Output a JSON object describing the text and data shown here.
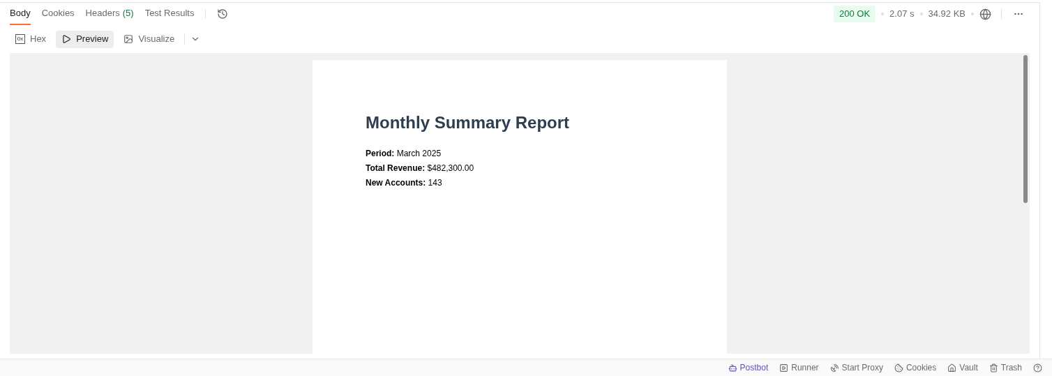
{
  "tabs": [
    {
      "label": "Body",
      "selected": true
    },
    {
      "label": "Cookies",
      "selected": false
    },
    {
      "label": "Headers",
      "count": "(5)",
      "selected": false
    },
    {
      "label": "Test Results",
      "selected": false
    }
  ],
  "status": {
    "code": "200 OK",
    "time": "2.07 s",
    "size": "34.92 KB"
  },
  "modes": [
    {
      "kind": "hex",
      "icon_text": "0x",
      "label": "Hex",
      "selected": false
    },
    {
      "kind": "preview",
      "label": "Preview",
      "selected": true
    },
    {
      "kind": "visualize",
      "label": "Visualize",
      "selected": false
    }
  ],
  "report": {
    "title": "Monthly Summary Report",
    "fields": [
      {
        "label": "Period:",
        "value": "March 2025"
      },
      {
        "label": "Total Revenue:",
        "value": "$482,300.00"
      },
      {
        "label": "New Accounts:",
        "value": "143"
      }
    ]
  },
  "footer": [
    {
      "kind": "postbot",
      "label": "Postbot",
      "highlighted": true
    },
    {
      "kind": "runner",
      "label": "Runner",
      "highlighted": false
    },
    {
      "kind": "proxy",
      "label": "Start Proxy",
      "highlighted": false
    },
    {
      "kind": "cookies",
      "label": "Cookies",
      "highlighted": false
    },
    {
      "kind": "vault",
      "label": "Vault",
      "highlighted": false
    },
    {
      "kind": "trash",
      "label": "Trash",
      "highlighted": false
    }
  ]
}
